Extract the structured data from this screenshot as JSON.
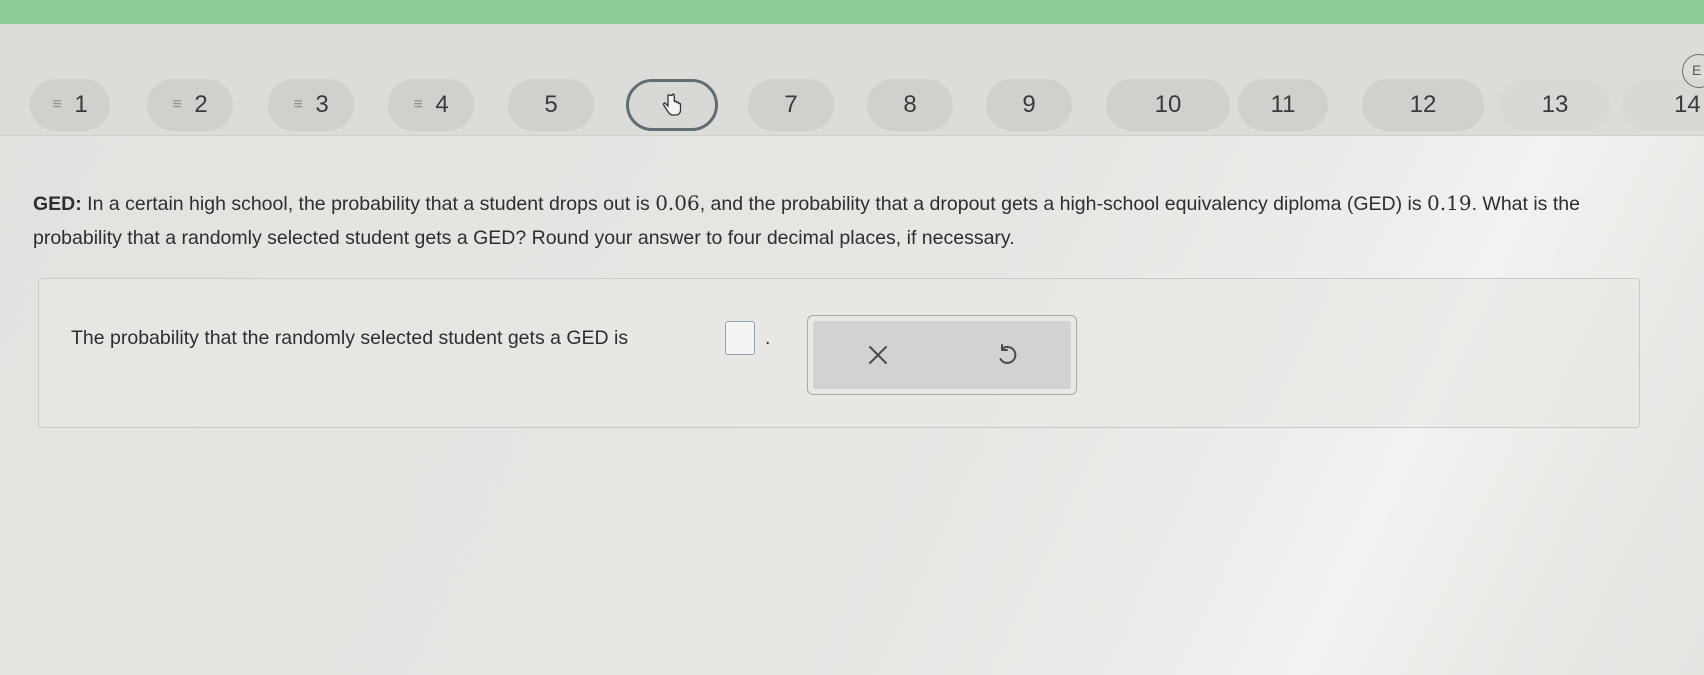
{
  "nav": {
    "items": [
      {
        "label": "1",
        "has_lines": true
      },
      {
        "label": "2",
        "has_lines": true
      },
      {
        "label": "3",
        "has_lines": true
      },
      {
        "label": "4",
        "has_lines": true
      },
      {
        "label": "5",
        "has_lines": false
      },
      {
        "label": "",
        "current": true
      },
      {
        "label": "7",
        "has_lines": false
      },
      {
        "label": "8",
        "has_lines": false
      },
      {
        "label": "9",
        "has_lines": false
      },
      {
        "label": "10",
        "has_lines": false
      },
      {
        "label": "11",
        "has_lines": false
      },
      {
        "label": "12",
        "has_lines": false
      },
      {
        "label": "13",
        "has_lines": false
      },
      {
        "label": "14",
        "has_lines": false
      }
    ],
    "corner_label": "E"
  },
  "question": {
    "topic": "GED:",
    "part1": " In a certain high school, the probability that a student drops out is ",
    "value1": "0.06",
    "part2": ", and the probability that a dropout gets a high-school equivalency diploma (GED) is ",
    "value2": "0.19",
    "part3": ". What is the probability that a randomly selected student gets a GED? Round your answer to four decimal places, if necessary."
  },
  "answer": {
    "prompt": "The probability that the randomly selected student gets a GED is",
    "value": "",
    "period": "."
  },
  "tools": {
    "clear_icon": "x-icon",
    "undo_icon": "undo-icon"
  },
  "colors": {
    "top_bar": "#8ccc98",
    "current_border": "#5f6e72"
  }
}
